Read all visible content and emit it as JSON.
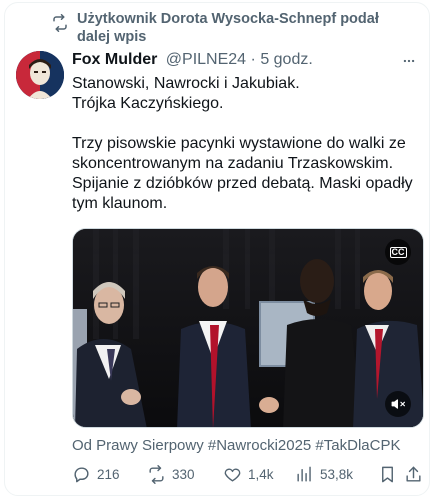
{
  "repost": {
    "label": "Użytkownik Dorota Wysocka-Schnepf podał dalej wpis",
    "icon": "repost-icon"
  },
  "tweet": {
    "author_name": "Fox Mulder",
    "handle": "@PILNE24",
    "separator": "·",
    "time": "5 godz.",
    "text_lines": [
      "Stanowski, Nawrocki i Jakubiak.\nTrójka Kaczyńskiego.",
      "Trzy pisowskie pacynki wystawione do walki ze skoncentrowanym na zadaniu Trzaskowskim. Spijanie z dzióbków przed debatą. Maski opadły tym klaunom."
    ],
    "media": {
      "type": "video",
      "cc_label": "CC",
      "cc_icon": "captions-icon",
      "mute_icon": "muted-speaker-icon"
    },
    "hashtags": "Od Prawy Sierpowy #Nawrocki2025 #TakDlaCPK"
  },
  "actions": {
    "replies": "216",
    "reposts": "330",
    "likes": "1,4k",
    "views": "53,8k"
  },
  "colors": {
    "text_primary": "#0f1419",
    "text_secondary": "#536471",
    "border": "#eff3f4"
  }
}
